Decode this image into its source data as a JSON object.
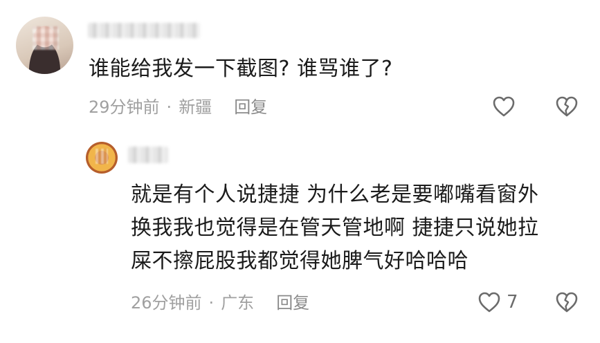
{
  "comments": [
    {
      "text": "谁能给我发一下截图? 谁骂谁了?",
      "time": "29分钟前",
      "separator": "·",
      "location": "新疆",
      "reply_label": "回复"
    }
  ],
  "reply": {
    "lines": [
      "就是有个人说捷捷 为什么老是要嘟嘴看窗外",
      "换我我也觉得是在管天管地啊 捷捷只说她拉",
      "屎不擦屁股我都觉得她脾气好哈哈哈"
    ],
    "time": "26分钟前",
    "separator": "·",
    "location": "广东",
    "reply_label": "回复",
    "like_count": "7"
  },
  "icons": {
    "like": "heart-outline-icon",
    "dislike": "broken-heart-icon"
  },
  "colors": {
    "text": "#1b1b1b",
    "meta": "#a0a0a0",
    "icon": "#6b6b6b"
  }
}
